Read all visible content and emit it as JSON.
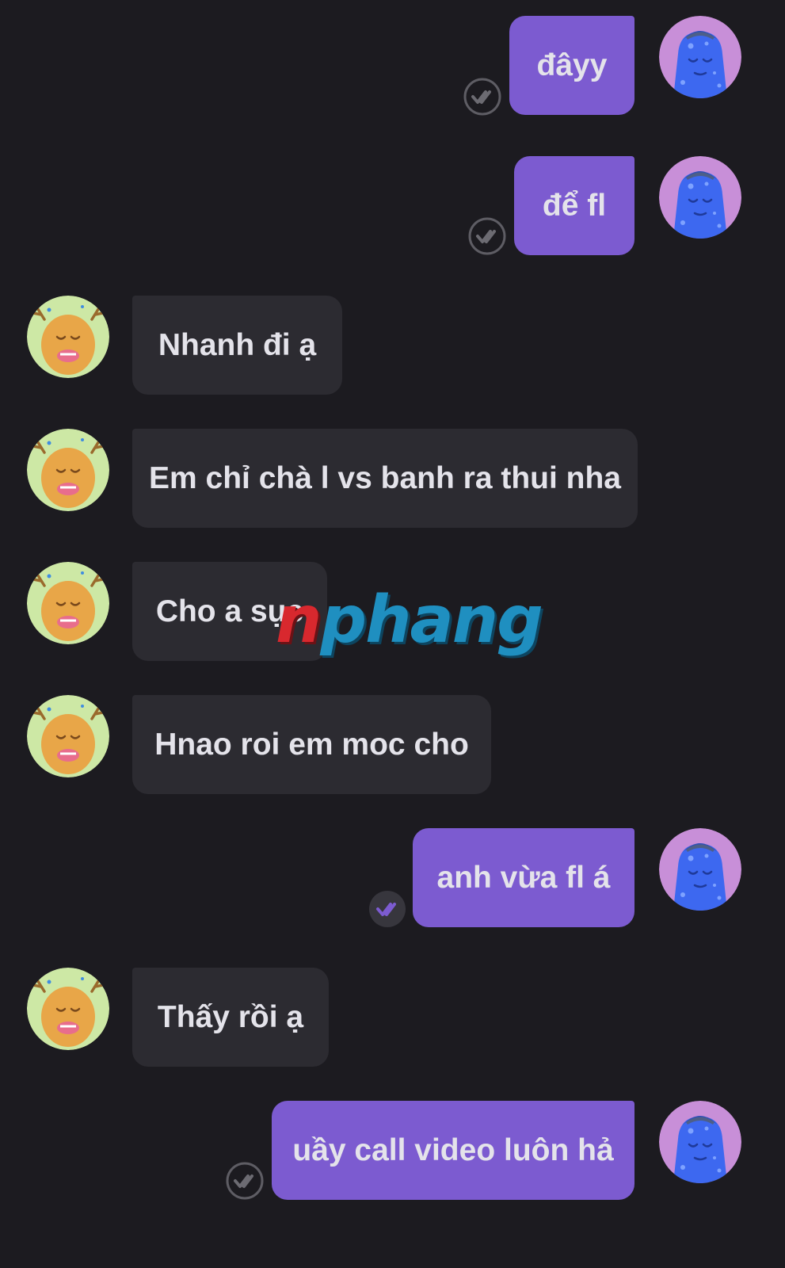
{
  "conversation": {
    "messages": [
      {
        "direction": "outgoing",
        "text": "đâyy",
        "receipt": "seen"
      },
      {
        "direction": "outgoing",
        "text": "để fl",
        "receipt": "seen"
      },
      {
        "direction": "incoming",
        "text": "Nhanh đi ạ"
      },
      {
        "direction": "incoming",
        "text": "Em chỉ chà l vs banh ra thui nha"
      },
      {
        "direction": "incoming",
        "text": "Cho a sục"
      },
      {
        "direction": "incoming",
        "text": "Hnao roi em moc cho"
      },
      {
        "direction": "outgoing",
        "text": "anh vừa fl á",
        "receipt": "delivered"
      },
      {
        "direction": "incoming",
        "text": "Thấy rồi ạ"
      },
      {
        "direction": "outgoing",
        "text": "uầy call video luôn hả",
        "receipt": "seen"
      }
    ]
  },
  "watermark": {
    "first_letter": "n",
    "rest": "phang"
  },
  "colors": {
    "background": "#1c1b20",
    "outgoing_bubble": "#7c5bd0",
    "incoming_bubble": "#2c2b31",
    "text": "#e4e3ea"
  },
  "icons": {
    "outgoing_avatar": "blue-character-avatar-icon",
    "incoming_avatar": "orange-monster-avatar-icon",
    "receipt": "double-check-icon"
  }
}
